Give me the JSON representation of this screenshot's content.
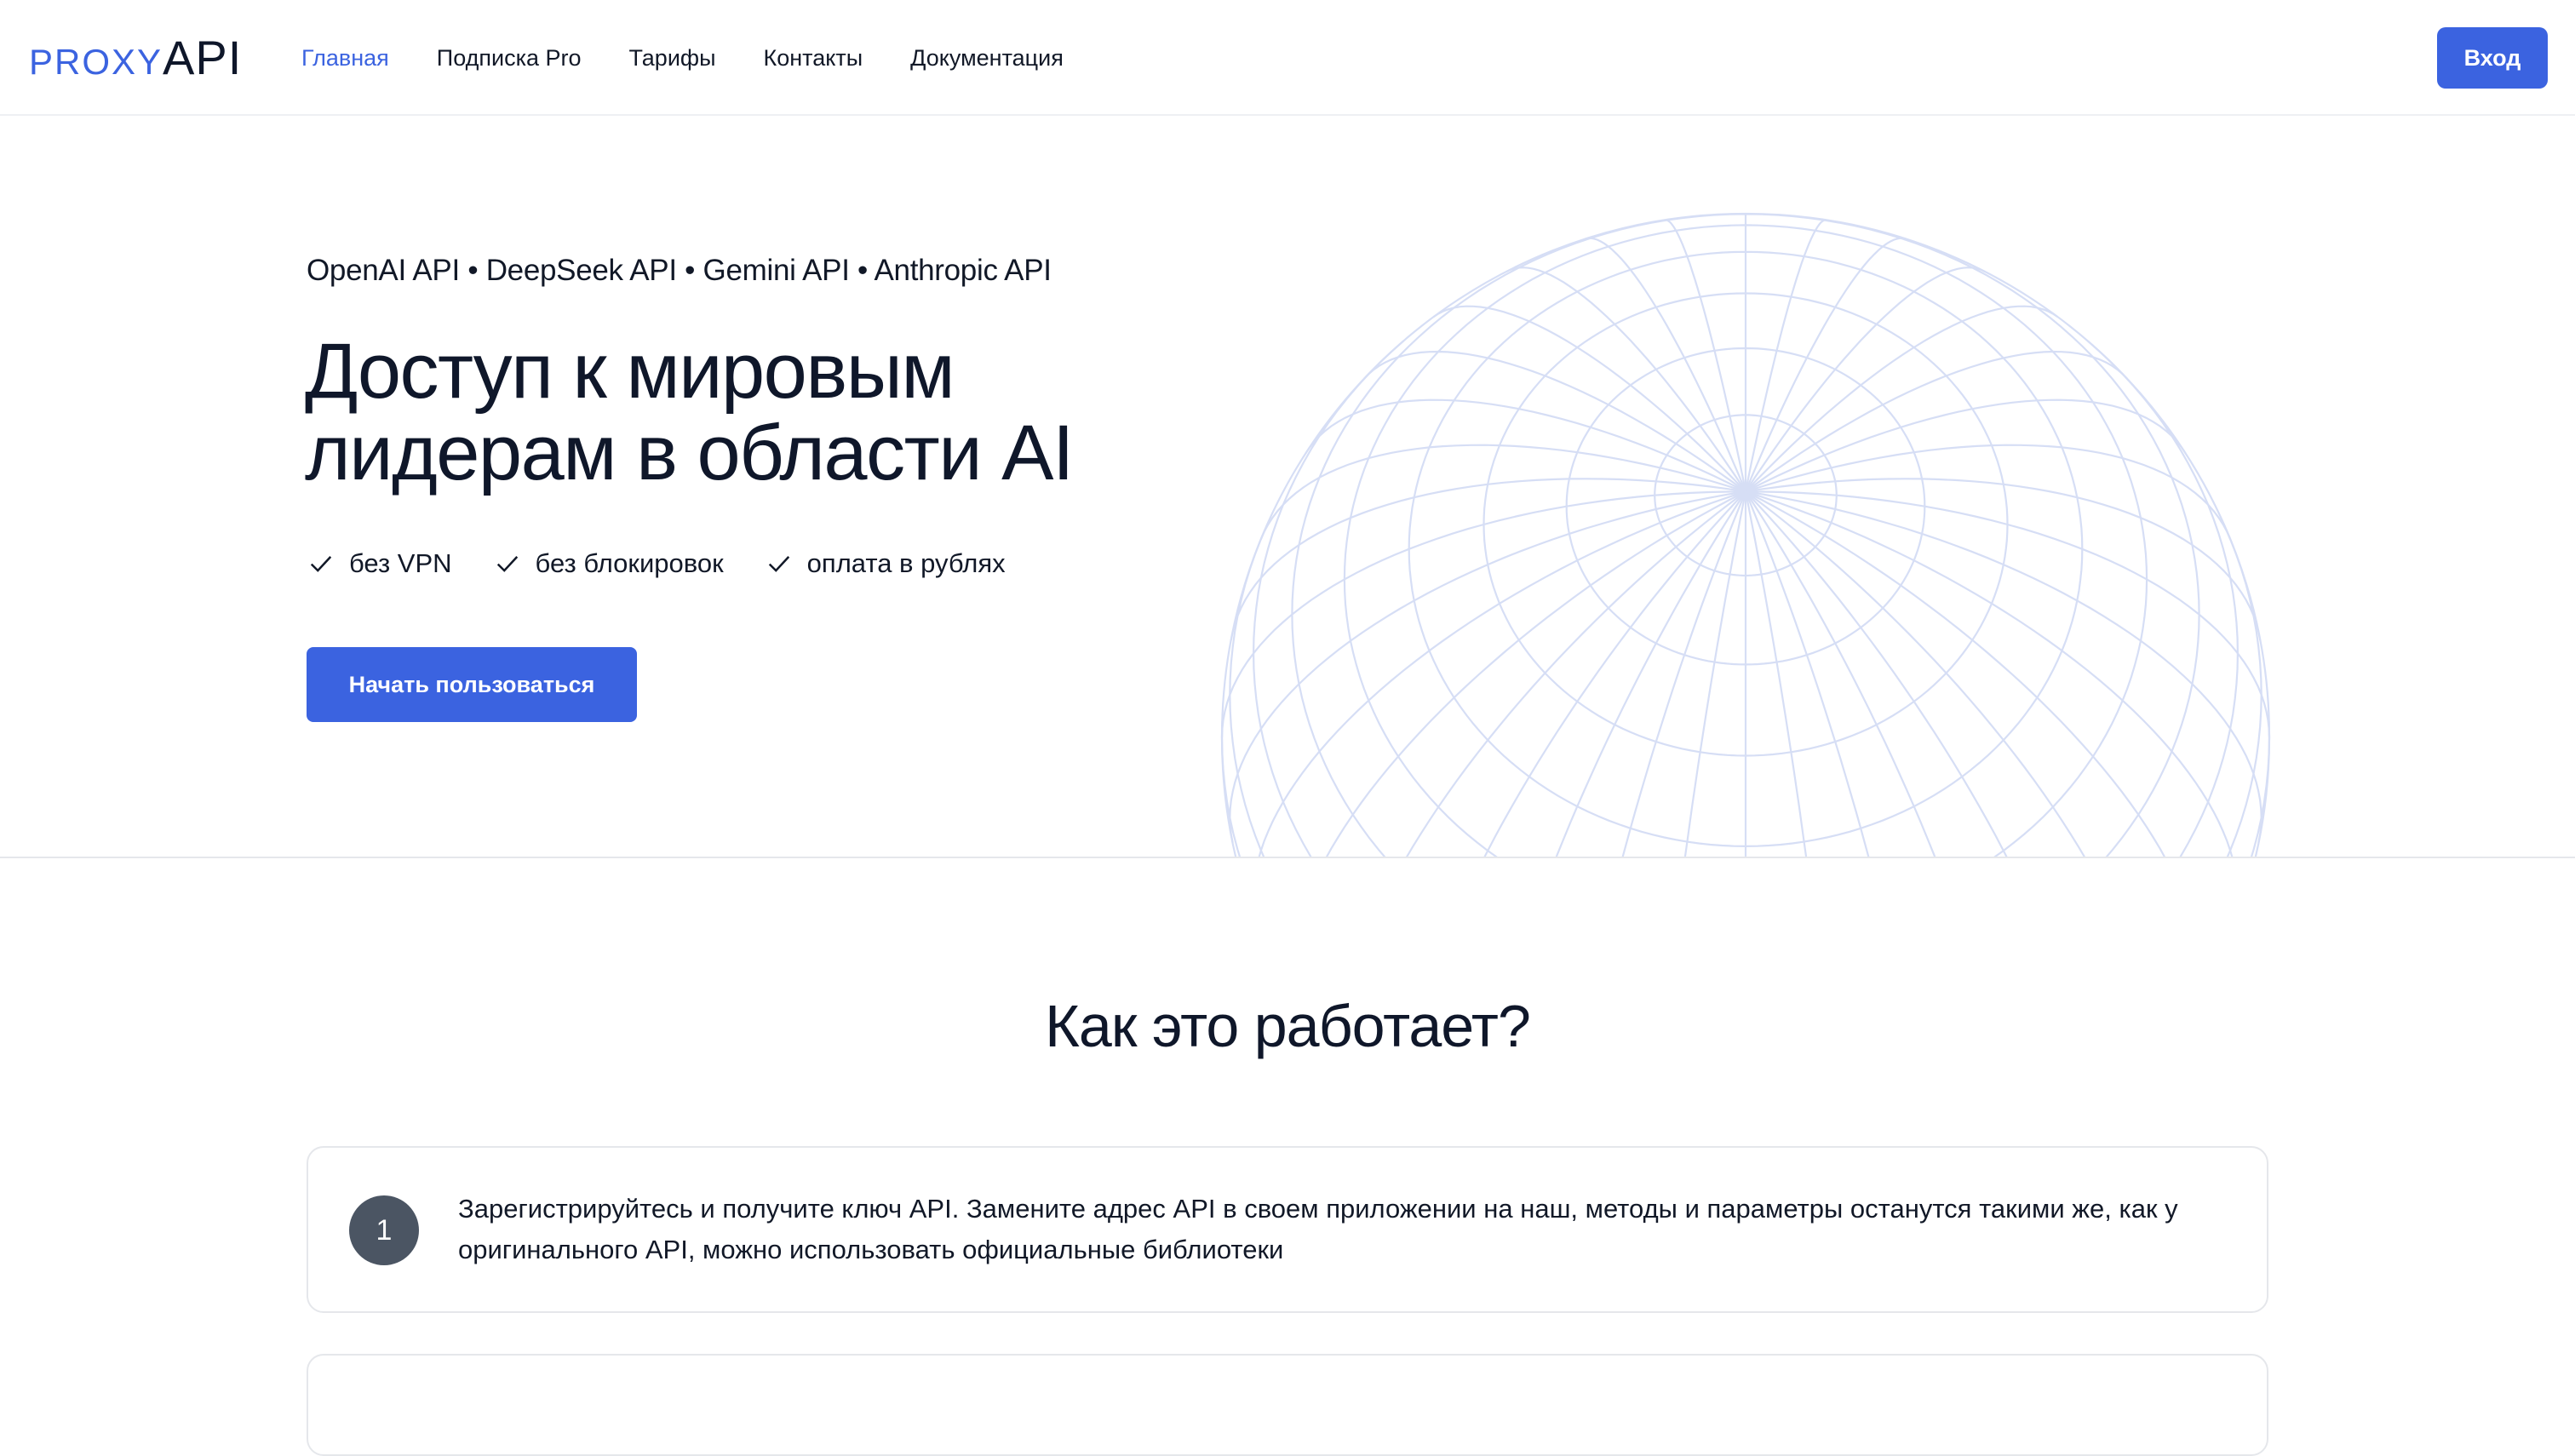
{
  "header": {
    "logo": {
      "proxy": "PROXY",
      "api": "API"
    },
    "nav": [
      {
        "label": "Главная",
        "active": true
      },
      {
        "label": "Подписка Pro",
        "active": false
      },
      {
        "label": "Тарифы",
        "active": false
      },
      {
        "label": "Контакты",
        "active": false
      },
      {
        "label": "Документация",
        "active": false
      }
    ],
    "login_label": "Вход"
  },
  "hero": {
    "tagline": "OpenAI API • DeepSeek API • Gemini API • Anthropic API",
    "title_line1": "Доступ к мировым",
    "title_line2": "лидерам в области AI",
    "features": [
      {
        "icon": "check-icon",
        "label": "без VPN"
      },
      {
        "icon": "check-icon",
        "label": "без блокировок"
      },
      {
        "icon": "check-icon",
        "label": "оплата в рублях"
      }
    ],
    "cta_label": "Начать пользоваться",
    "globe_icon": "globe-wireframe"
  },
  "how_it_works": {
    "title": "Как это работает?",
    "steps": [
      {
        "number": "1",
        "text": "Зарегистрируйтесь и получите ключ API. Замените адрес API в своем приложении на наш, методы и параметры останутся такими же, как у оригинального API, можно использовать официальные библиотеки"
      }
    ]
  },
  "colors": {
    "accent": "#3b63e0",
    "text": "#0f172a",
    "border": "#e5e7eb",
    "globe_lines": "#d6def5",
    "step_badge": "#4b5563"
  }
}
